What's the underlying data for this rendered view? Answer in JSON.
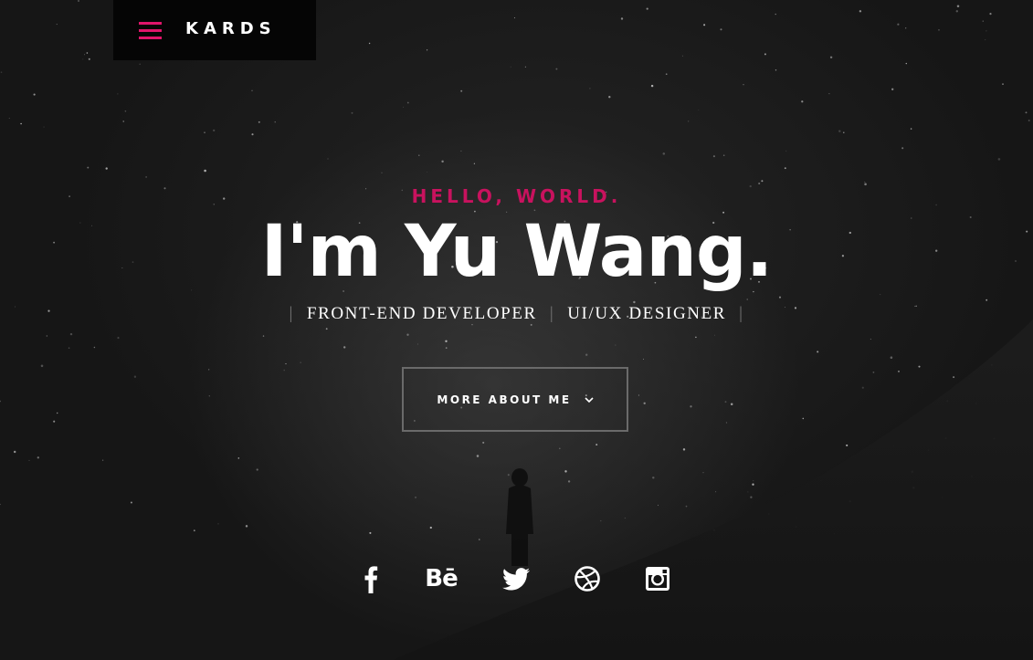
{
  "nav": {
    "logo": "KARDS",
    "menu_icon": "hamburger-menu-icon"
  },
  "hero": {
    "greeting": "HELLO, WORLD.",
    "name": "I'm Yu Wang.",
    "roles": [
      "FRONT-END DEVELOPER",
      "UI/UX DESIGNER"
    ],
    "separator": "|",
    "button_label": "MORE ABOUT ME",
    "button_icon": "chevron-down-icon"
  },
  "social": [
    {
      "name": "facebook-icon"
    },
    {
      "name": "behance-icon",
      "text": "Bē"
    },
    {
      "name": "twitter-icon"
    },
    {
      "name": "dribbble-icon"
    },
    {
      "name": "instagram-icon"
    }
  ],
  "colors": {
    "accent": "#c8125e",
    "menu_accent": "#e0156b",
    "background": "#161616",
    "topbar": "#050505"
  }
}
